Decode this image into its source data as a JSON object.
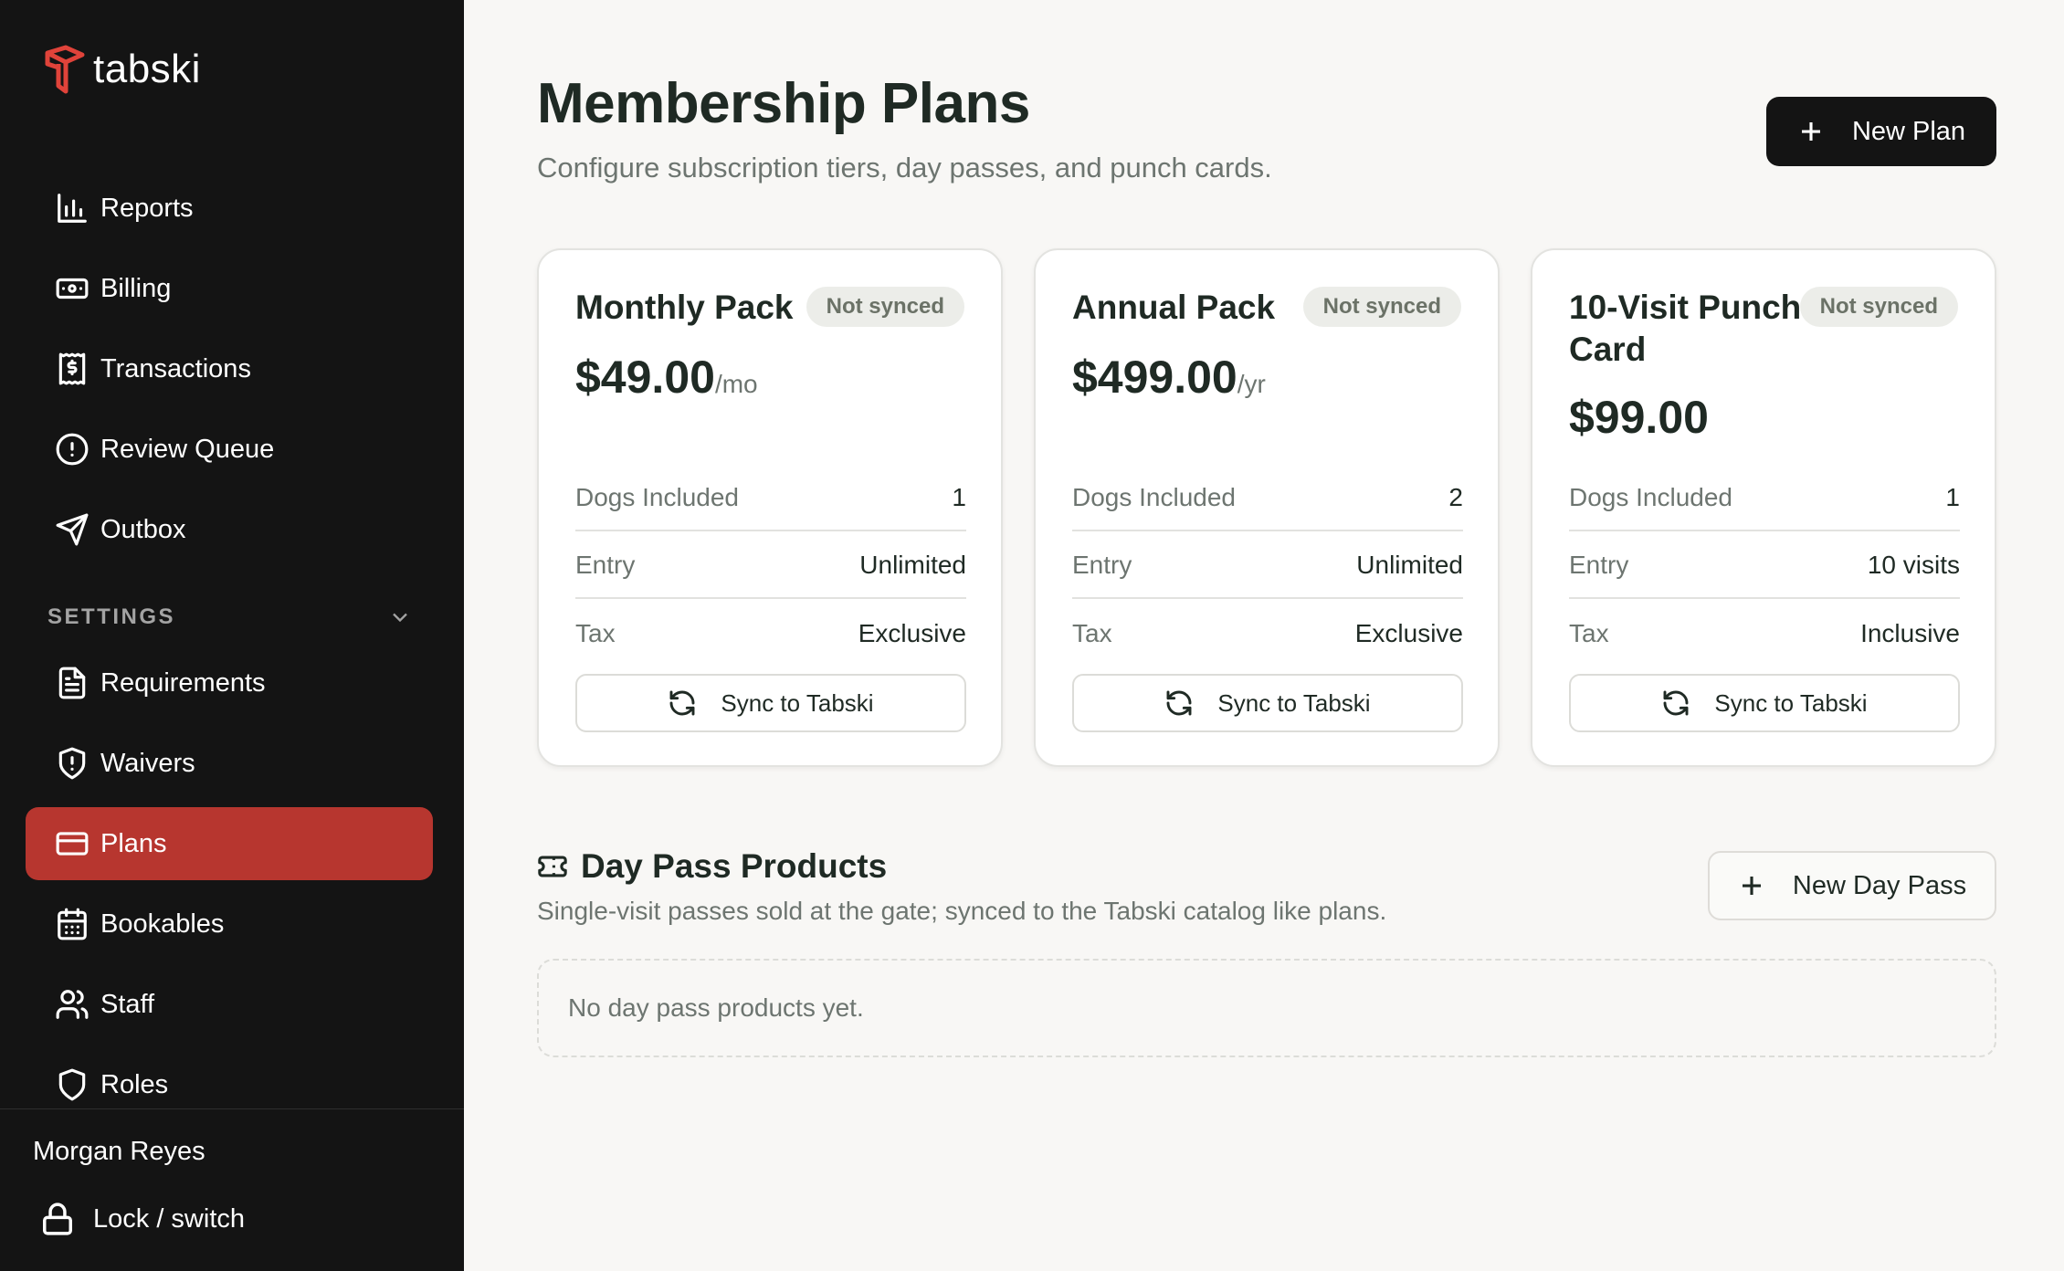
{
  "brand": {
    "name": "tabski",
    "color": "#e0433a"
  },
  "sidebar": {
    "items": [
      {
        "label": "Reports",
        "icon": "bar-chart-icon"
      },
      {
        "label": "Billing",
        "icon": "banknote-icon"
      },
      {
        "label": "Transactions",
        "icon": "receipt-icon"
      },
      {
        "label": "Review Queue",
        "icon": "alert-circle-icon"
      },
      {
        "label": "Outbox",
        "icon": "send-icon"
      }
    ],
    "settings_label": "SETTINGS",
    "settings_items": [
      {
        "label": "Requirements",
        "icon": "file-text-icon"
      },
      {
        "label": "Waivers",
        "icon": "shield-alert-icon"
      },
      {
        "label": "Plans",
        "icon": "credit-card-icon",
        "active": true
      },
      {
        "label": "Bookables",
        "icon": "calendar-icon"
      },
      {
        "label": "Staff",
        "icon": "users-icon"
      },
      {
        "label": "Roles",
        "icon": "shield-icon"
      }
    ],
    "user_name": "Morgan Reyes",
    "lock_label": "Lock / switch",
    "active_color": "#b7362f"
  },
  "header": {
    "title": "Membership Plans",
    "subtitle": "Configure subscription tiers, day passes, and punch cards.",
    "new_plan_label": "New Plan"
  },
  "plans": [
    {
      "name": "Monthly Pack",
      "status": "Not synced",
      "price": "$49.00",
      "period": "/mo",
      "rows": [
        {
          "k": "Dogs Included",
          "v": "1"
        },
        {
          "k": "Entry",
          "v": "Unlimited"
        },
        {
          "k": "Tax",
          "v": "Exclusive"
        }
      ],
      "sync_label": "Sync to Tabski"
    },
    {
      "name": "Annual Pack",
      "status": "Not synced",
      "price": "$499.00",
      "period": "/yr",
      "rows": [
        {
          "k": "Dogs Included",
          "v": "2"
        },
        {
          "k": "Entry",
          "v": "Unlimited"
        },
        {
          "k": "Tax",
          "v": "Exclusive"
        }
      ],
      "sync_label": "Sync to Tabski"
    },
    {
      "name": "10-Visit Punch Card",
      "name_line1": "10-Visit Punch",
      "name_line2": "Card",
      "status": "Not synced",
      "price": "$99.00",
      "period": "",
      "rows": [
        {
          "k": "Dogs Included",
          "v": "1"
        },
        {
          "k": "Entry",
          "v": "10 visits"
        },
        {
          "k": "Tax",
          "v": "Inclusive"
        }
      ],
      "sync_label": "Sync to Tabski"
    }
  ],
  "day_pass": {
    "title": "Day Pass Products",
    "subtitle": "Single-visit passes sold at the gate; synced to the Tabski catalog like plans.",
    "new_label": "New Day Pass",
    "empty_text": "No day pass products yet."
  }
}
